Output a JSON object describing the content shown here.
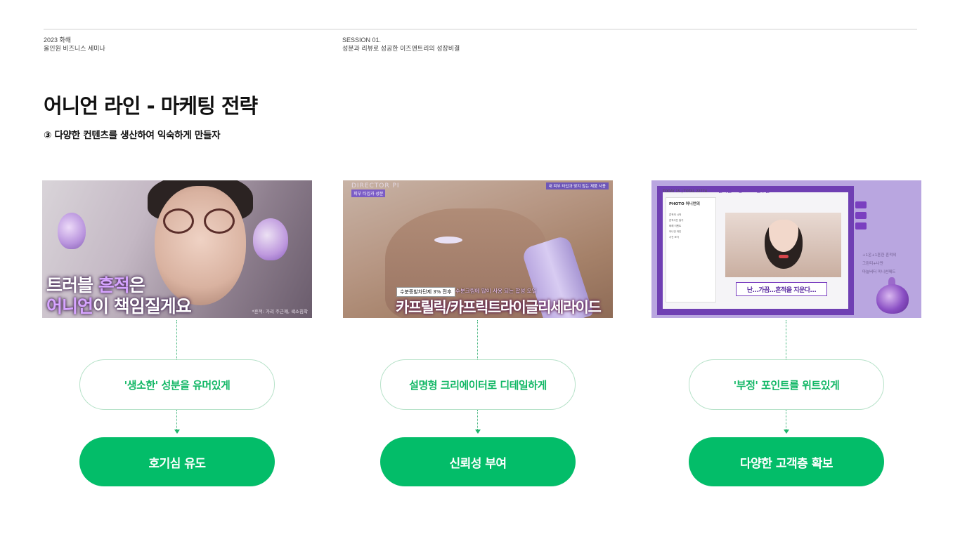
{
  "header": {
    "left_line1": "2023 화해",
    "left_line2": "올인원 비즈니스 세미나",
    "right_line1": "SESSION 01.",
    "right_line2": "성분과 리뷰로 성공한 이즈앤트리의 성장비결"
  },
  "title": "어니언 라인 - 마케팅 전략",
  "subtitle": "③ 다양한 컨텐츠를 생산하여 익숙하게 만들자",
  "columns": [
    {
      "thumbnail": {
        "caption_line1_a": "트러블 ",
        "caption_line1_b": "흔적",
        "caption_line1_c": "은",
        "caption_line2_a": "어니언",
        "caption_line2_b": "이 책임질게요",
        "source": "*흔적: 가리 주근깨, 색소침착"
      },
      "approach": "'생소한' 성분을 유머있게",
      "result": "호기심 유도"
    },
    {
      "thumbnail": {
        "brand": "DIRECTOR PI",
        "brand_tag": "피부 타입과 성분",
        "top_tag": "내 피부 타입과 맞지 않는 제품 사용",
        "small_caption1": "수분증발차단제 3% 전후",
        "small_caption2": "수분크림에 많이 사용 되는 합성 오일",
        "big_caption": "카프릴릭/카프릭트라이글리세라이드"
      },
      "approach": "설명형 크리에이터로 디테일하게",
      "result": "신뢰성 부여"
    },
    {
      "thumbnail": {
        "header": "TODAY 15 | TOTAL 22774",
        "header_title": "흔적일드 @l∙o∙l 친구들~",
        "sidebar_title": "PHOTO 어니언의",
        "rows": [
          "흔적의 시작",
          "흔적사진 일기",
          "화해 이벤트",
          "어니언 라인",
          "사진 보기"
        ],
        "caption": "난…가끔…흔적을 지운다…",
        "right_text": [
          "+1온+1흔한 흔적의",
          "그린티+나만",
          "마늘버터 미니썬패드"
        ]
      },
      "approach": "'부정' 포인트를 위트있게",
      "result": "다양한 고객층 확보"
    }
  ]
}
